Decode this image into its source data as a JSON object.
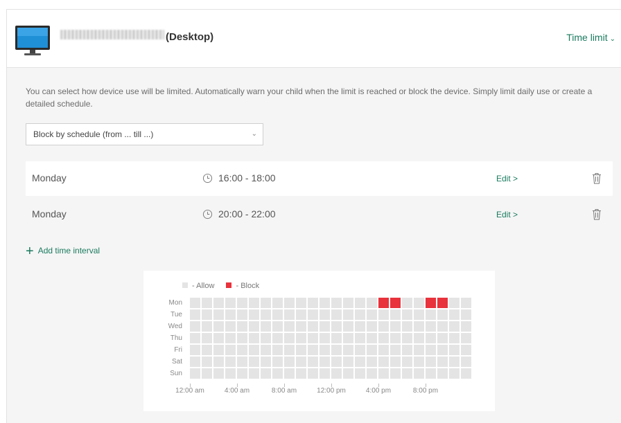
{
  "header": {
    "device_title": "(Desktop)",
    "mode_label": "Time limit"
  },
  "description": "You can select how device use will be limited. Automatically warn your child when the limit is reached or block the device. Simply limit daily use or create a detailed schedule.",
  "limit_select": {
    "value": "Block by schedule (from ... till ...)"
  },
  "intervals": [
    {
      "day": "Monday",
      "time": "16:00 - 18:00",
      "edit_label": "Edit >"
    },
    {
      "day": "Monday",
      "time": "20:00 - 22:00",
      "edit_label": "Edit >"
    }
  ],
  "add_interval_label": "Add time interval",
  "schedule_chart": {
    "legend": {
      "allow": "- Allow",
      "block": "- Block"
    },
    "colors": {
      "allow": "#e4e4e4",
      "block": "#e8323c"
    },
    "days": [
      "Mon",
      "Tue",
      "Wed",
      "Thu",
      "Fri",
      "Sat",
      "Sun"
    ],
    "hour_labels": [
      "12:00 am",
      "4:00 am",
      "8:00 am",
      "12:00 pm",
      "4:00 pm",
      "8:00 pm"
    ],
    "blocked": [
      {
        "day": "Mon",
        "hours": [
          16,
          17,
          20,
          21
        ]
      }
    ]
  },
  "icons": {
    "device": "desktop-monitor-icon",
    "time": "clock-icon",
    "delete": "trash-icon",
    "add": "plus-icon",
    "dropdown": "chevron-down-icon"
  },
  "accent_color": "#1a7a5e"
}
